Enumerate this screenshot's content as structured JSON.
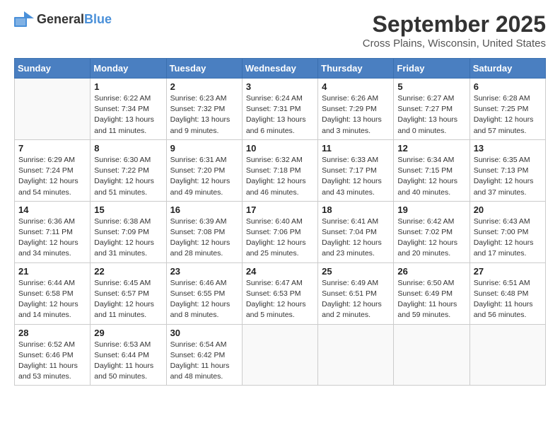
{
  "logo": {
    "general": "General",
    "blue": "Blue"
  },
  "title": "September 2025",
  "location": "Cross Plains, Wisconsin, United States",
  "weekdays": [
    "Sunday",
    "Monday",
    "Tuesday",
    "Wednesday",
    "Thursday",
    "Friday",
    "Saturday"
  ],
  "weeks": [
    [
      {
        "day": "",
        "lines": []
      },
      {
        "day": "1",
        "lines": [
          "Sunrise: 6:22 AM",
          "Sunset: 7:34 PM",
          "Daylight: 13 hours",
          "and 11 minutes."
        ]
      },
      {
        "day": "2",
        "lines": [
          "Sunrise: 6:23 AM",
          "Sunset: 7:32 PM",
          "Daylight: 13 hours",
          "and 9 minutes."
        ]
      },
      {
        "day": "3",
        "lines": [
          "Sunrise: 6:24 AM",
          "Sunset: 7:31 PM",
          "Daylight: 13 hours",
          "and 6 minutes."
        ]
      },
      {
        "day": "4",
        "lines": [
          "Sunrise: 6:26 AM",
          "Sunset: 7:29 PM",
          "Daylight: 13 hours",
          "and 3 minutes."
        ]
      },
      {
        "day": "5",
        "lines": [
          "Sunrise: 6:27 AM",
          "Sunset: 7:27 PM",
          "Daylight: 13 hours",
          "and 0 minutes."
        ]
      },
      {
        "day": "6",
        "lines": [
          "Sunrise: 6:28 AM",
          "Sunset: 7:25 PM",
          "Daylight: 12 hours",
          "and 57 minutes."
        ]
      }
    ],
    [
      {
        "day": "7",
        "lines": [
          "Sunrise: 6:29 AM",
          "Sunset: 7:24 PM",
          "Daylight: 12 hours",
          "and 54 minutes."
        ]
      },
      {
        "day": "8",
        "lines": [
          "Sunrise: 6:30 AM",
          "Sunset: 7:22 PM",
          "Daylight: 12 hours",
          "and 51 minutes."
        ]
      },
      {
        "day": "9",
        "lines": [
          "Sunrise: 6:31 AM",
          "Sunset: 7:20 PM",
          "Daylight: 12 hours",
          "and 49 minutes."
        ]
      },
      {
        "day": "10",
        "lines": [
          "Sunrise: 6:32 AM",
          "Sunset: 7:18 PM",
          "Daylight: 12 hours",
          "and 46 minutes."
        ]
      },
      {
        "day": "11",
        "lines": [
          "Sunrise: 6:33 AM",
          "Sunset: 7:17 PM",
          "Daylight: 12 hours",
          "and 43 minutes."
        ]
      },
      {
        "day": "12",
        "lines": [
          "Sunrise: 6:34 AM",
          "Sunset: 7:15 PM",
          "Daylight: 12 hours",
          "and 40 minutes."
        ]
      },
      {
        "day": "13",
        "lines": [
          "Sunrise: 6:35 AM",
          "Sunset: 7:13 PM",
          "Daylight: 12 hours",
          "and 37 minutes."
        ]
      }
    ],
    [
      {
        "day": "14",
        "lines": [
          "Sunrise: 6:36 AM",
          "Sunset: 7:11 PM",
          "Daylight: 12 hours",
          "and 34 minutes."
        ]
      },
      {
        "day": "15",
        "lines": [
          "Sunrise: 6:38 AM",
          "Sunset: 7:09 PM",
          "Daylight: 12 hours",
          "and 31 minutes."
        ]
      },
      {
        "day": "16",
        "lines": [
          "Sunrise: 6:39 AM",
          "Sunset: 7:08 PM",
          "Daylight: 12 hours",
          "and 28 minutes."
        ]
      },
      {
        "day": "17",
        "lines": [
          "Sunrise: 6:40 AM",
          "Sunset: 7:06 PM",
          "Daylight: 12 hours",
          "and 25 minutes."
        ]
      },
      {
        "day": "18",
        "lines": [
          "Sunrise: 6:41 AM",
          "Sunset: 7:04 PM",
          "Daylight: 12 hours",
          "and 23 minutes."
        ]
      },
      {
        "day": "19",
        "lines": [
          "Sunrise: 6:42 AM",
          "Sunset: 7:02 PM",
          "Daylight: 12 hours",
          "and 20 minutes."
        ]
      },
      {
        "day": "20",
        "lines": [
          "Sunrise: 6:43 AM",
          "Sunset: 7:00 PM",
          "Daylight: 12 hours",
          "and 17 minutes."
        ]
      }
    ],
    [
      {
        "day": "21",
        "lines": [
          "Sunrise: 6:44 AM",
          "Sunset: 6:58 PM",
          "Daylight: 12 hours",
          "and 14 minutes."
        ]
      },
      {
        "day": "22",
        "lines": [
          "Sunrise: 6:45 AM",
          "Sunset: 6:57 PM",
          "Daylight: 12 hours",
          "and 11 minutes."
        ]
      },
      {
        "day": "23",
        "lines": [
          "Sunrise: 6:46 AM",
          "Sunset: 6:55 PM",
          "Daylight: 12 hours",
          "and 8 minutes."
        ]
      },
      {
        "day": "24",
        "lines": [
          "Sunrise: 6:47 AM",
          "Sunset: 6:53 PM",
          "Daylight: 12 hours",
          "and 5 minutes."
        ]
      },
      {
        "day": "25",
        "lines": [
          "Sunrise: 6:49 AM",
          "Sunset: 6:51 PM",
          "Daylight: 12 hours",
          "and 2 minutes."
        ]
      },
      {
        "day": "26",
        "lines": [
          "Sunrise: 6:50 AM",
          "Sunset: 6:49 PM",
          "Daylight: 11 hours",
          "and 59 minutes."
        ]
      },
      {
        "day": "27",
        "lines": [
          "Sunrise: 6:51 AM",
          "Sunset: 6:48 PM",
          "Daylight: 11 hours",
          "and 56 minutes."
        ]
      }
    ],
    [
      {
        "day": "28",
        "lines": [
          "Sunrise: 6:52 AM",
          "Sunset: 6:46 PM",
          "Daylight: 11 hours",
          "and 53 minutes."
        ]
      },
      {
        "day": "29",
        "lines": [
          "Sunrise: 6:53 AM",
          "Sunset: 6:44 PM",
          "Daylight: 11 hours",
          "and 50 minutes."
        ]
      },
      {
        "day": "30",
        "lines": [
          "Sunrise: 6:54 AM",
          "Sunset: 6:42 PM",
          "Daylight: 11 hours",
          "and 48 minutes."
        ]
      },
      {
        "day": "",
        "lines": []
      },
      {
        "day": "",
        "lines": []
      },
      {
        "day": "",
        "lines": []
      },
      {
        "day": "",
        "lines": []
      }
    ]
  ]
}
